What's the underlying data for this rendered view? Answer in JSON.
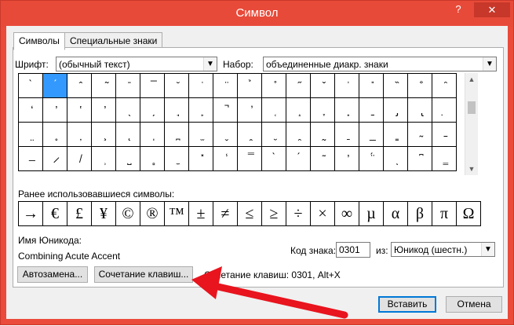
{
  "window": {
    "title": "Символ",
    "help_label": "?",
    "close_label": "✕"
  },
  "tabs": [
    {
      "label": "Символы"
    },
    {
      "label": "Специальные знаки"
    }
  ],
  "font": {
    "label": "Шрифт:",
    "value": "(обычный текст)"
  },
  "subset": {
    "label": "Набор:",
    "value": "объединенные диакр. знаки"
  },
  "grid": {
    "rows": [
      [
        "̀",
        "́",
        "̂",
        "̃",
        "̄",
        "̅",
        "̆",
        "̇",
        "̈",
        "̉",
        "̊",
        "̋",
        "̌",
        "̍",
        "̎",
        "̏",
        "̐",
        "̑"
      ],
      [
        "̒",
        "̓",
        "̔",
        "̕",
        "̖",
        "̗",
        "̘",
        "̙",
        "̚",
        "̛",
        "̜",
        "̝",
        "̞",
        "̟",
        "̠",
        "̡",
        "̢",
        "̣"
      ],
      [
        "̤",
        "̥",
        "̦",
        "̧",
        "̨",
        "̩",
        "̪",
        "̫",
        "̬",
        "̭",
        "̮",
        "̯",
        "̰",
        "̱",
        "̲",
        "̳",
        "̴",
        "̵"
      ],
      [
        "̶",
        "̷",
        "̸",
        "̹",
        "̺",
        "̻",
        "̼",
        "̽",
        "̾",
        "̿",
        "̀",
        "́",
        "͂",
        "̓",
        "̈́",
        "ͅ",
        "͆",
        "͇"
      ]
    ],
    "selected": {
      "row": 0,
      "col": 1
    }
  },
  "recent": {
    "label": "Ранее использовавшиеся символы:",
    "symbols": [
      "→",
      "€",
      "£",
      "¥",
      "©",
      "®",
      "™",
      "±",
      "≠",
      "≤",
      "≥",
      "÷",
      "×",
      "∞",
      "µ",
      "α",
      "β",
      "π",
      "Ω"
    ]
  },
  "unicode_name": {
    "label": "Имя Юникода:",
    "value": "Combining Acute Accent"
  },
  "char_code": {
    "label": "Код знака:",
    "value": "0301"
  },
  "from": {
    "label": "из:",
    "value": "Юникод (шестн.)"
  },
  "buttons": {
    "autocorrect": "Автозамена...",
    "shortcut_key": "Сочетание клавиш...",
    "insert": "Вставить",
    "cancel": "Отмена"
  },
  "shortcut_text": "Сочетание клавиш: 0301, Alt+X",
  "colors": {
    "titlebar": "#e84a39",
    "selection": "#3399ff",
    "annotation_arrow": "#e8141e"
  }
}
